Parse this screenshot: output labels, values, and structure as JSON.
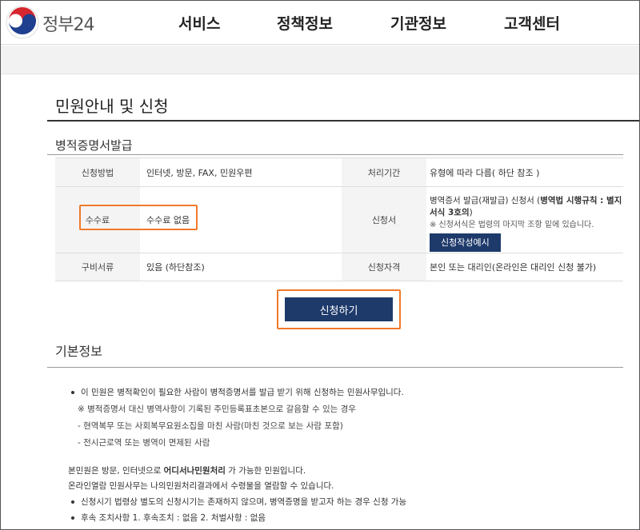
{
  "header": {
    "logo_text": "정부24",
    "menu": [
      "서비스",
      "정책정보",
      "기관정보",
      "고객센터"
    ]
  },
  "page": {
    "title": "민원안내 및 신청",
    "section_title": "병적증명서발급"
  },
  "info_table": {
    "method_label": "신청방법",
    "method_value": "인터넷, 방문, FAX, 민원우편",
    "period_label": "처리기간",
    "period_value": "유형에 따라 다름( 하단 참조 )",
    "fee_label": "수수료",
    "fee_value": "수수료 없음",
    "form_label": "신청서",
    "form_value_prefix": "병역증서 발급(재발급) 신청서 (",
    "form_value_bold": "병역법 시행규칙 : 별지서식 3호의",
    "form_value_suffix": ")",
    "form_note": "※ 신청서식은 법령의 마지막 조항 밑에 있습니다.",
    "form_button": "신청작성예시",
    "docs_label": "구비서류",
    "docs_value": "있음 (하단참조)",
    "qual_label": "신청자격",
    "qual_value": "본인 또는 대리인(온라인은 대리인 신청 불가)"
  },
  "apply_button": "신청하기",
  "basic": {
    "title": "기본정보",
    "line1": "이 민원은 병적확인이 필요한 사람이 병적증명서를 발급 받기 위해 신청하는 민원사무입니다.",
    "line2": "※ 병적증명서 대신 병역사항이 기록된 주민등록표초본으로 갈음할 수 있는 경우",
    "line3": "- 현역복무 또는 사회복무요원소집을 마친 사람(마친 것으로 보는 사람 포함)",
    "line4": "- 전시근로역 또는 병역이 면제된 사람",
    "line5_prefix": "본민원은 방문, 인터넷으로 ",
    "line5_bold": "어디서나민원처리",
    "line5_suffix": " 가 가능한 민원입니다.",
    "line6": "온라인열람 민원사무는 나의민원처리결과에서 수령물을 열람할 수 있습니다.",
    "line7": "신청시기 법령상 별도의 신청시기는 존재하지 않으며, 병역증명을 받고자 하는 경우 신청 가능",
    "line8": "후속 조치사항 1. 후속조치 : 없음 2. 처벌사항 : 없음"
  }
}
